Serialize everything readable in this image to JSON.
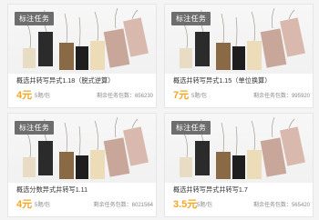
{
  "cards": [
    {
      "badge": "标注任务",
      "title": "概选井转写异式1.18（脱式逆算）",
      "price": "4元",
      "unit": "5题/包",
      "remaining": "剩余任务包数：656230"
    },
    {
      "badge": "标注任务",
      "title": "概选井转写异式1.15（单位换算）",
      "price": "7元",
      "unit": "5题/包",
      "remaining": "剩余任务包数：995920"
    },
    {
      "badge": "标注任务",
      "title": "概选分数异式井转写1.11",
      "price": "4元",
      "unit": "5题/包",
      "remaining": "剩余任务包数：6021564"
    },
    {
      "badge": "标注任务",
      "title": "概选井转写异式井转写1.7",
      "price": "3.5元",
      "unit": "5题/包",
      "remaining": "剩余任务包数：565420"
    }
  ],
  "colors": {
    "price": "#f5a623",
    "badge_bg": "#6d6d6d"
  }
}
